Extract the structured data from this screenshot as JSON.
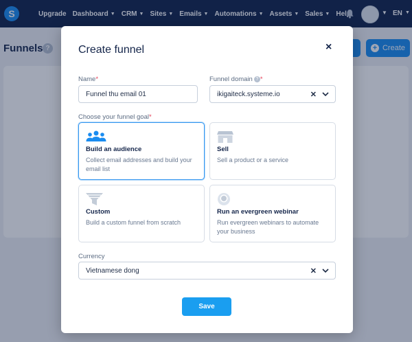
{
  "nav": {
    "logo": "S",
    "items": [
      {
        "label": "Upgrade",
        "dropdown": false
      },
      {
        "label": "Dashboard",
        "dropdown": true
      },
      {
        "label": "CRM",
        "dropdown": true
      },
      {
        "label": "Sites",
        "dropdown": true
      },
      {
        "label": "Emails",
        "dropdown": true
      },
      {
        "label": "Automations",
        "dropdown": true
      },
      {
        "label": "Assets",
        "dropdown": true
      },
      {
        "label": "Sales",
        "dropdown": true
      },
      {
        "label": "Help",
        "dropdown": false
      }
    ],
    "language": "EN"
  },
  "page": {
    "title": "Funnels",
    "help": "?",
    "create_button": "Create"
  },
  "modal": {
    "title": "Create funnel",
    "close": "×",
    "name_label": "Name",
    "name_value": "Funnel thu email 01",
    "domain_label": "Funnel domain",
    "domain_value": "ikigaiteck.systeme.io",
    "goal_label": "Choose your funnel goal",
    "goals": [
      {
        "title": "Build an audience",
        "desc": "Collect email addresses and build your email list",
        "icon": "audience-icon",
        "selected": true
      },
      {
        "title": "Sell",
        "desc": "Sell a product or a service",
        "icon": "store-icon",
        "selected": false
      },
      {
        "title": "Custom",
        "desc": "Build a custom funnel from scratch",
        "icon": "funnel-icon",
        "selected": false
      },
      {
        "title": "Run an evergreen webinar",
        "desc": "Run evergreen webinars to automate your business",
        "icon": "webinar-icon",
        "selected": false
      }
    ],
    "currency_label": "Currency",
    "currency_value": "Vietnamese dong",
    "save": "Save",
    "required_mark": "*"
  },
  "colors": {
    "nav_bg": "#10224a",
    "accent": "#1a8cf0",
    "required": "#e53e56"
  }
}
